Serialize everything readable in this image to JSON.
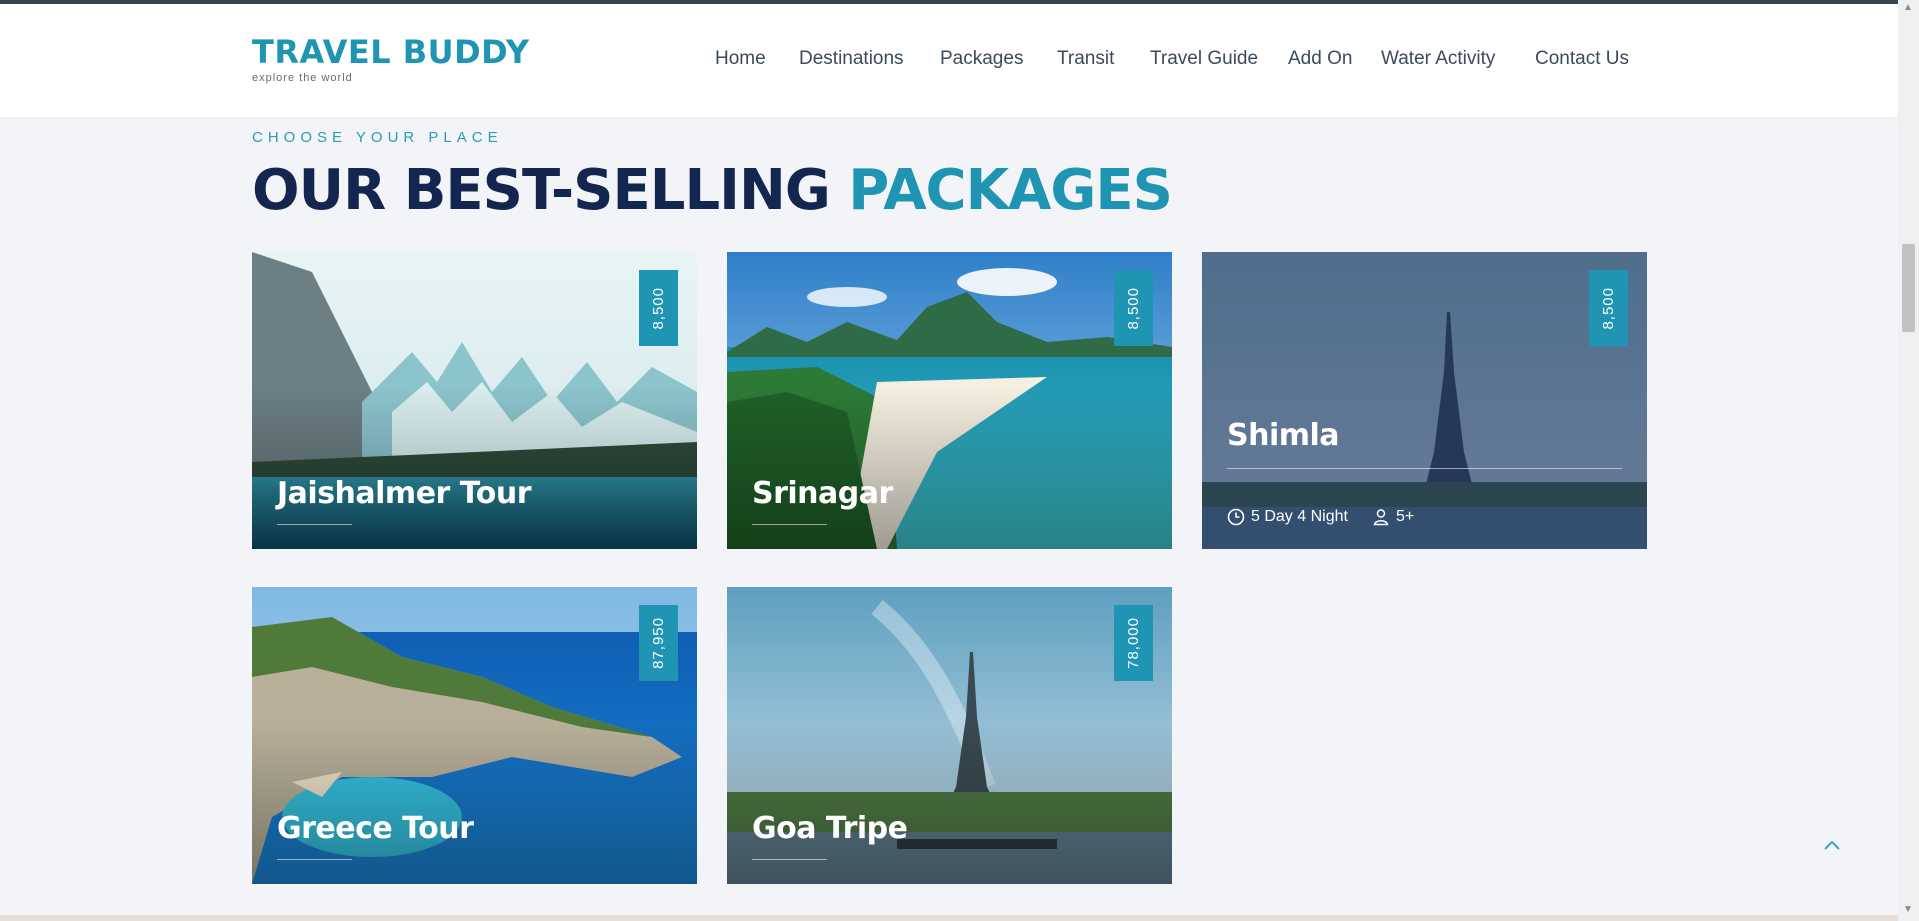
{
  "brand": {
    "title": "TRAVEL BUDDY",
    "tagline": "explore the world",
    "accent": "#1f95b3",
    "navy": "#12264f"
  },
  "nav": {
    "items": [
      {
        "label": "Home"
      },
      {
        "label": "Destinations"
      },
      {
        "label": "Packages"
      },
      {
        "label": "Transit"
      },
      {
        "label": "Travel Guide"
      },
      {
        "label": "Add On"
      },
      {
        "label": "Water Activity"
      },
      {
        "label": "Contact Us"
      }
    ]
  },
  "section": {
    "eyebrow": "CHOOSE YOUR PLACE",
    "heading_main": "OUR BEST-SELLING",
    "heading_accent": "PACKAGES"
  },
  "packages": [
    {
      "title": "Jaishalmer Tour",
      "price": "8,500",
      "image": "mountain-lake-photo"
    },
    {
      "title": "Srinagar",
      "price": "8,500",
      "image": "tropical-beach-photo"
    },
    {
      "title": "Shimla",
      "price": "8,500",
      "image": "eiffel-tower-photo",
      "duration": "5 Day 4 Night",
      "people": "5+",
      "state": "hovered"
    },
    {
      "title": "Greece Tour",
      "price": "87,950",
      "image": "coastal-cliff-bay-photo"
    },
    {
      "title": "Goa Tripe",
      "price": "78,000",
      "image": "eiffel-tower-river-photo"
    }
  ],
  "icons": {
    "duration": "clock-icon",
    "people": "user-icon",
    "back_to_top": "chevron-up-icon"
  }
}
